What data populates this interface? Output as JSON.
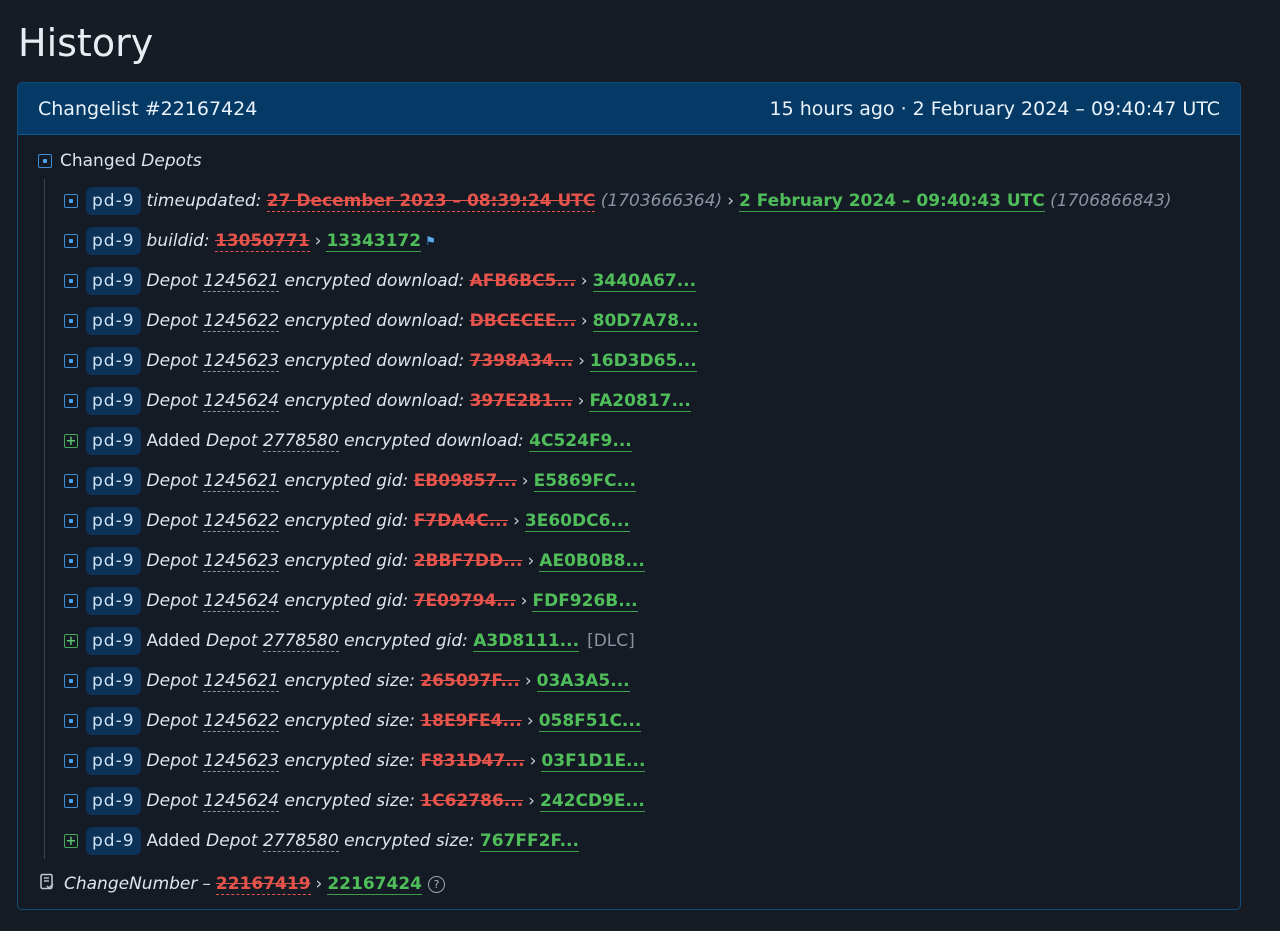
{
  "page": {
    "title": "History"
  },
  "changelist": {
    "title": "Changelist #22167424",
    "time": "15 hours ago · 2 February 2024 – 09:40:47 UTC"
  },
  "section": {
    "label_pre": "Changed",
    "label_em": "Depots"
  },
  "rows": [
    {
      "type": "changed",
      "badge": "pd-9",
      "key": "timeupdated:",
      "old": "27 December 2023 – 08:39:24 UTC",
      "old_extra": "(1703666364)",
      "sep": "›",
      "new": "2 February 2024 – 09:40:43 UTC",
      "new_extra": "(1706866843)"
    },
    {
      "type": "changed",
      "badge": "pd-9",
      "key": "buildid:",
      "old": "13050771",
      "sep": "›",
      "new": "13343172"
    },
    {
      "type": "changed",
      "badge": "pd-9",
      "depot_label": "Depot",
      "depot": "1245621",
      "key": "encrypted download:",
      "old": "AFB6BC5...",
      "sep": "›",
      "new": "3440A67..."
    },
    {
      "type": "changed",
      "badge": "pd-9",
      "depot_label": "Depot",
      "depot": "1245622",
      "key": "encrypted download:",
      "old": "DBCECEE...",
      "sep": "›",
      "new": "80D7A78..."
    },
    {
      "type": "changed",
      "badge": "pd-9",
      "depot_label": "Depot",
      "depot": "1245623",
      "key": "encrypted download:",
      "old": "7398A34...",
      "sep": "›",
      "new": "16D3D65..."
    },
    {
      "type": "changed",
      "badge": "pd-9",
      "depot_label": "Depot",
      "depot": "1245624",
      "key": "encrypted download:",
      "old": "397E2B1...",
      "sep": "›",
      "new": "FA20817..."
    },
    {
      "type": "added",
      "badge": "pd-9",
      "added": "Added",
      "depot_label": "Depot",
      "depot": "2778580",
      "key": "encrypted download:",
      "new": "4C524F9..."
    },
    {
      "type": "changed",
      "badge": "pd-9",
      "depot_label": "Depot",
      "depot": "1245621",
      "key": "encrypted gid:",
      "old": "EB09857...",
      "sep": "›",
      "new": "E5869FC..."
    },
    {
      "type": "changed",
      "badge": "pd-9",
      "depot_label": "Depot",
      "depot": "1245622",
      "key": "encrypted gid:",
      "old": "F7DA4C...",
      "sep": "›",
      "new": "3E60DC6..."
    },
    {
      "type": "changed",
      "badge": "pd-9",
      "depot_label": "Depot",
      "depot": "1245623",
      "key": "encrypted gid:",
      "old": "2BBF7DD...",
      "sep": "›",
      "new": "AE0B0B8..."
    },
    {
      "type": "changed",
      "badge": "pd-9",
      "depot_label": "Depot",
      "depot": "1245624",
      "key": "encrypted gid:",
      "old": "7E09794...",
      "sep": "›",
      "new": "FDF926B..."
    },
    {
      "type": "added",
      "badge": "pd-9",
      "added": "Added",
      "depot_label": "Depot",
      "depot": "2778580",
      "key": "encrypted gid:",
      "new": "A3D8111...",
      "tag": "[DLC]"
    },
    {
      "type": "changed",
      "badge": "pd-9",
      "depot_label": "Depot",
      "depot": "1245621",
      "key": "encrypted size:",
      "old": "265097F...",
      "sep": "›",
      "new": "03A3A5..."
    },
    {
      "type": "changed",
      "badge": "pd-9",
      "depot_label": "Depot",
      "depot": "1245622",
      "key": "encrypted size:",
      "old": "18E9FE4...",
      "sep": "›",
      "new": "058F51C..."
    },
    {
      "type": "changed",
      "badge": "pd-9",
      "depot_label": "Depot",
      "depot": "1245623",
      "key": "encrypted size:",
      "old": "F831D47...",
      "sep": "›",
      "new": "03F1D1E..."
    },
    {
      "type": "changed",
      "badge": "pd-9",
      "depot_label": "Depot",
      "depot": "1245624",
      "key": "encrypted size:",
      "old": "1C62786...",
      "sep": "›",
      "new": "242CD9E..."
    },
    {
      "type": "added",
      "badge": "pd-9",
      "added": "Added",
      "depot_label": "Depot",
      "depot": "2778580",
      "key": "encrypted size:",
      "new": "767FF2F..."
    }
  ],
  "footer": {
    "label": "ChangeNumber",
    "dash": "–",
    "old": "22167419",
    "sep": "›",
    "new": "22167424",
    "help": "?"
  },
  "colors": {
    "old": "#e5534b",
    "new": "#4fbd59",
    "header": "#053a66",
    "accent": "#3b8ed8"
  }
}
